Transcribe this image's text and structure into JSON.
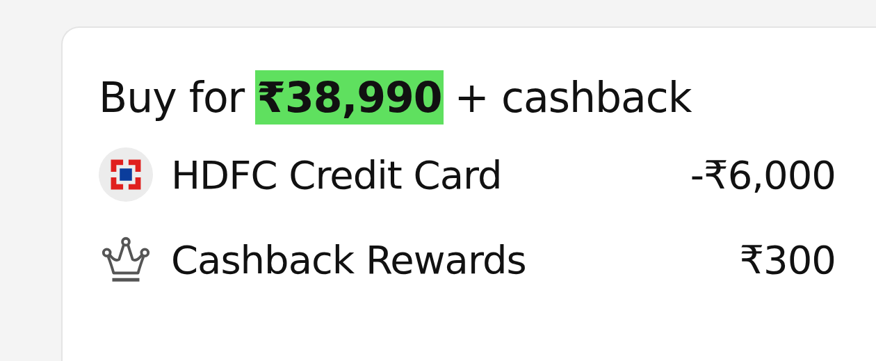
{
  "offer": {
    "prefix": "Buy for",
    "price": "₹38,990",
    "suffix": "+ cashback"
  },
  "rows": [
    {
      "kind": "bank",
      "label": "HDFC Credit Card",
      "amount": "-₹6,000"
    },
    {
      "kind": "rewards",
      "label": "Cashback Rewards",
      "amount": "₹300"
    }
  ]
}
